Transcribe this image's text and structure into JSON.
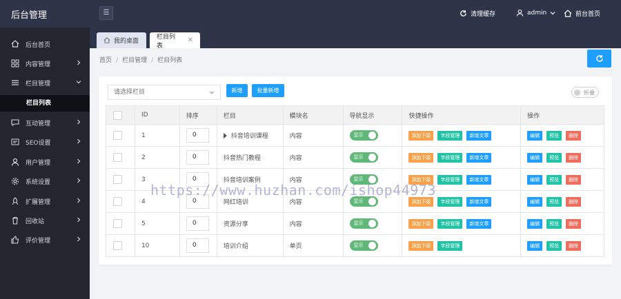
{
  "app": {
    "title": "后台管理"
  },
  "topbar": {
    "clear_cache": "清理缓存",
    "user": "admin",
    "frontend": "前台首页"
  },
  "sidebar": {
    "items": [
      {
        "label": "后台首页",
        "icon": "home-icon",
        "arrow": false
      },
      {
        "label": "内容管理",
        "icon": "grid-icon",
        "arrow": true
      },
      {
        "label": "栏目管理",
        "icon": "list-icon",
        "arrow": true,
        "expanded": true
      },
      {
        "label": "互动管理",
        "icon": "chat-icon",
        "arrow": true
      },
      {
        "label": "SEO设置",
        "icon": "seo-icon",
        "arrow": true
      },
      {
        "label": "用户管理",
        "icon": "user-icon",
        "arrow": true
      },
      {
        "label": "系统设置",
        "icon": "gear-icon",
        "arrow": true
      },
      {
        "label": "扩展管理",
        "icon": "rocket-icon",
        "arrow": true
      },
      {
        "label": "回收站",
        "icon": "trash-icon",
        "arrow": true
      },
      {
        "label": "评价管理",
        "icon": "thumb-icon",
        "arrow": true
      }
    ],
    "sub_active": "栏目列表"
  },
  "tabs": {
    "home": "我的桌面",
    "active": "栏目列表"
  },
  "breadcrumb": [
    "首页",
    "栏目管理",
    "栏目列表"
  ],
  "toolbar": {
    "select_placeholder": "请选择栏目",
    "add": "新增",
    "batch_add": "批量新增",
    "fold": "折叠"
  },
  "table": {
    "headers": [
      "ID",
      "排序",
      "栏目",
      "模块名",
      "导航显示",
      "快捷操作",
      "操作"
    ],
    "rows": [
      {
        "id": "1",
        "sort": "0",
        "name": "抖音培训课程",
        "has_children": true,
        "module": "内容",
        "nav": "显示",
        "quick": [
          "添加下级",
          "字段管理",
          "新增文章"
        ]
      },
      {
        "id": "2",
        "sort": "0",
        "name": "抖音热门教程",
        "has_children": false,
        "module": "内容",
        "nav": "显示",
        "quick": [
          "添加下级",
          "字段管理",
          "新增文章"
        ]
      },
      {
        "id": "3",
        "sort": "0",
        "name": "抖音培训案例",
        "has_children": false,
        "module": "内容",
        "nav": "显示",
        "quick": [
          "添加下级",
          "字段管理",
          "新增文章"
        ]
      },
      {
        "id": "4",
        "sort": "0",
        "name": "网红培训",
        "has_children": false,
        "module": "内容",
        "nav": "显示",
        "quick": [
          "添加下级",
          "字段管理",
          "新增文章"
        ]
      },
      {
        "id": "5",
        "sort": "0",
        "name": "资源分享",
        "has_children": false,
        "module": "内容",
        "nav": "显示",
        "quick": [
          "添加下级",
          "字段管理",
          "新增文章"
        ]
      },
      {
        "id": "10",
        "sort": "0",
        "name": "培训介绍",
        "has_children": false,
        "module": "单页",
        "nav": "显示",
        "quick": [
          "添加下级",
          "字段管理"
        ]
      }
    ],
    "actions": [
      "编辑",
      "预览",
      "删除"
    ]
  },
  "watermark": "https://www.huzhan.com/ishop44973",
  "colors": {
    "topbar": "#2f3549",
    "sidebar": "#23262e",
    "primary": "#1e9fff",
    "switch_on": "#5fb878",
    "orange": "#f7a24a",
    "teal": "#20c4a4",
    "red": "#ef6b5c"
  }
}
